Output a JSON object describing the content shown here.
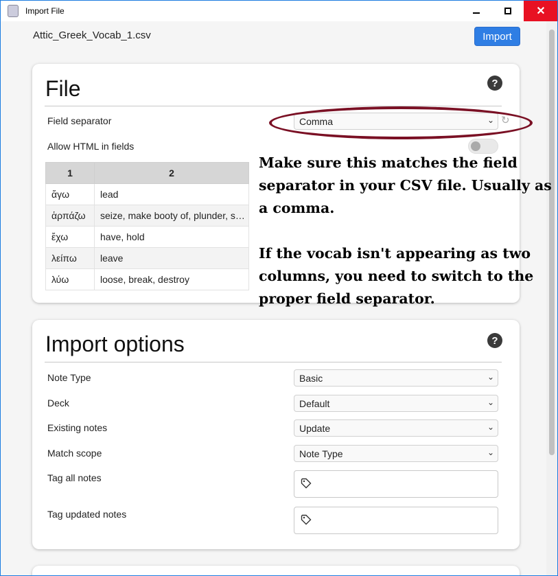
{
  "window": {
    "title": "Import File",
    "controls": {
      "minimize": "minimize",
      "maximize": "maximize",
      "close": "close"
    }
  },
  "header": {
    "filename": "Attic_Greek_Vocab_1.csv",
    "import_label": "Import"
  },
  "file_section": {
    "title": "File",
    "field_separator_label": "Field separator",
    "field_separator_value": "Comma",
    "allow_html_label": "Allow HTML in fields",
    "allow_html_on": false,
    "preview": {
      "columns": [
        "1",
        "2"
      ],
      "rows": [
        [
          "ἄγω",
          "lead"
        ],
        [
          "ἁρπάζω",
          "seize, make booty of, plunder, snatch away"
        ],
        [
          "ἔχω",
          "have, hold"
        ],
        [
          "λείπω",
          "leave"
        ],
        [
          "λύω",
          "loose, break, destroy"
        ]
      ]
    }
  },
  "import_options": {
    "title": "Import options",
    "note_type_label": "Note Type",
    "note_type_value": "Basic",
    "deck_label": "Deck",
    "deck_value": "Default",
    "existing_notes_label": "Existing notes",
    "existing_notes_value": "Update",
    "match_scope_label": "Match scope",
    "match_scope_value": "Note Type",
    "tag_all_label": "Tag all notes",
    "tag_updated_label": "Tag updated notes"
  },
  "annotation": {
    "line1": "Make sure this matches the field separator in your CSV file. Usually as a comma.",
    "line2": "If the vocab isn't appearing as two columns, you need to switch to the proper field separator.",
    "color": "#7a1024"
  },
  "colors": {
    "accent": "#2f7ee4",
    "close": "#e81123"
  }
}
